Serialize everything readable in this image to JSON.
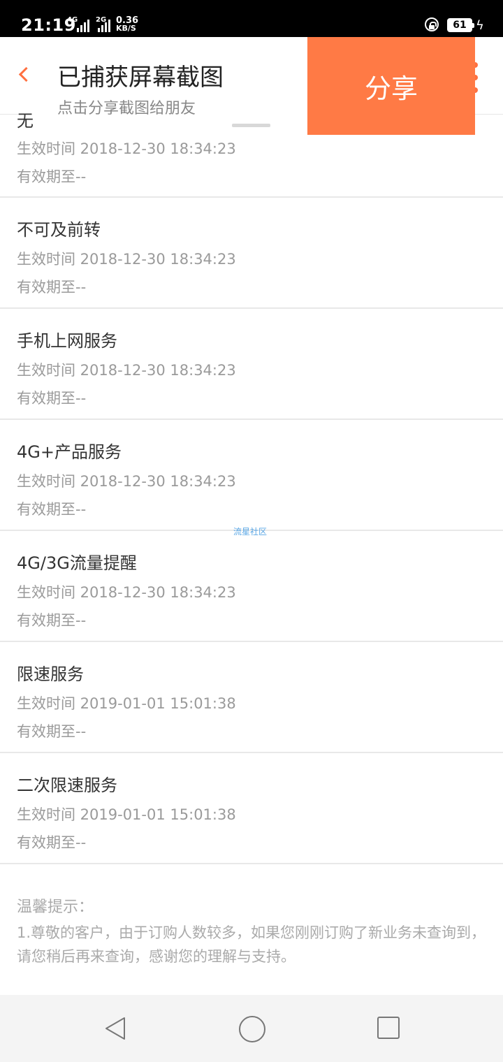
{
  "status_bar": {
    "time": "21:19",
    "network_1": "4G",
    "network_2": "2G",
    "speed_value": "0.36",
    "speed_unit": "KB/S",
    "battery": "61"
  },
  "capture_toast": {
    "title": "已捕获屏幕截图",
    "subtitle": "点击分享截图给朋友",
    "share_label": "分享"
  },
  "services": [
    {
      "name": "无",
      "effective": "生效时间 2018-12-30 18:34:23",
      "expiry": "有效期至--"
    },
    {
      "name": "不可及前转",
      "effective": "生效时间 2018-12-30 18:34:23",
      "expiry": "有效期至--"
    },
    {
      "name": "手机上网服务",
      "effective": "生效时间 2018-12-30 18:34:23",
      "expiry": "有效期至--"
    },
    {
      "name": "4G+产品服务",
      "effective": "生效时间 2018-12-30 18:34:23",
      "expiry": "有效期至--"
    },
    {
      "name": "4G/3G流量提醒",
      "effective": "生效时间 2018-12-30 18:34:23",
      "expiry": "有效期至--"
    },
    {
      "name": "限速服务",
      "effective": "生效时间 2019-01-01 15:01:38",
      "expiry": "有效期至--"
    },
    {
      "name": "二次限速服务",
      "effective": "生效时间 2019-01-01 15:01:38",
      "expiry": "有效期至--"
    }
  ],
  "watermark": "流星社区",
  "tips": {
    "title": "温馨提示：",
    "body": "1.尊敬的客户，由于订购人数较多，如果您刚刚订购了新业务未查询到，请您稍后再来查询，感谢您的理解与支持。"
  },
  "colors": {
    "accent": "#ff7040",
    "share_bg": "#ff7a45"
  },
  "icons": [
    "back-icon",
    "more-icon",
    "lock-icon",
    "battery-icon",
    "nav-back-icon",
    "nav-home-icon",
    "nav-recent-icon"
  ]
}
